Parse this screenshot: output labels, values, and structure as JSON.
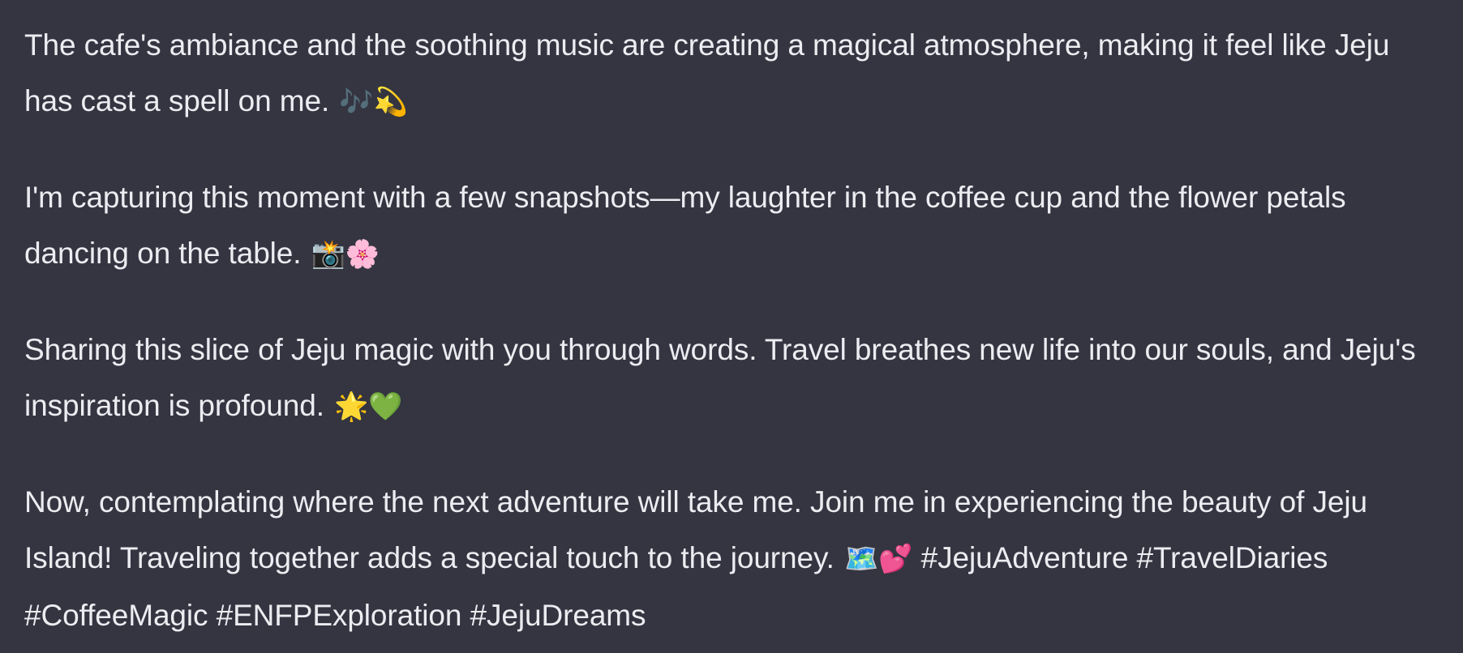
{
  "message": {
    "paragraphs": [
      {
        "text": "The cafe's ambiance and the soothing music are creating a magical atmosphere, making it feel like Jeju has cast a spell on me.",
        "emoji": "🎶💫"
      },
      {
        "text": "I'm capturing this moment with a few snapshots—my laughter in the coffee cup and the flower petals dancing on the table.",
        "emoji": "📸🌸"
      },
      {
        "text": "Sharing this slice of Jeju magic with you through words. Travel breathes new life into our souls, and Jeju's inspiration is profound.",
        "emoji": "🌟💚"
      },
      {
        "text": "Now, contemplating where the next adventure will take me. Join me in experiencing the beauty of Jeju Island! Traveling together adds a special touch to the journey.",
        "emoji": "🗺️💕",
        "hashtags": "#JejuAdventure #TravelDiaries #CoffeeMagic #ENFPExploration #JejuDreams"
      }
    ]
  }
}
